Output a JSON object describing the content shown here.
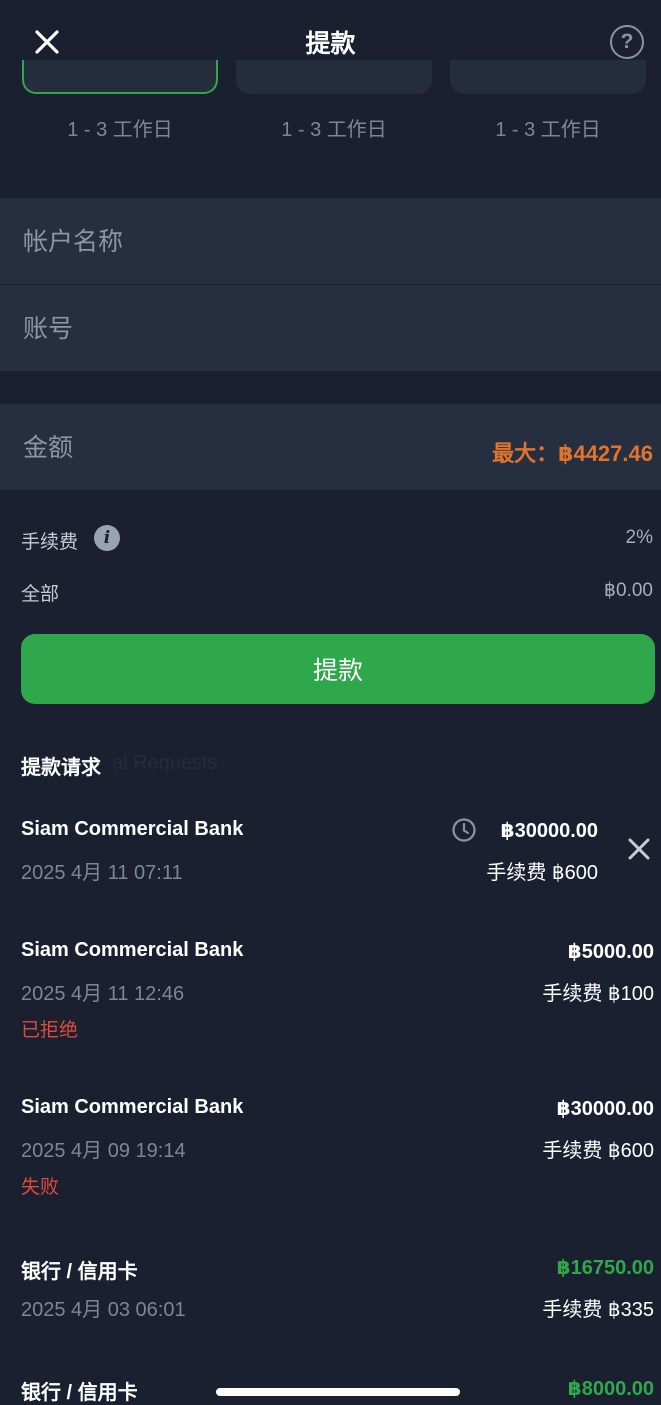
{
  "header": {
    "title": "提款",
    "close_icon": "close-icon",
    "help_icon": "help-icon",
    "help_glyph": "?"
  },
  "methods": [
    {
      "eta": "1 - 3 工作日",
      "selected": true
    },
    {
      "eta": "1 - 3 工作日",
      "selected": false
    },
    {
      "eta": "1 - 3 工作日",
      "selected": false
    }
  ],
  "form": {
    "account_name_placeholder": "帐户名称",
    "account_number_placeholder": "账号",
    "amount_placeholder": "金额",
    "max_label": "最大：฿4427.46"
  },
  "summary": {
    "fee_label": "手续费",
    "fee_value": "2%",
    "fee_info_glyph": "i",
    "total_label": "全部",
    "total_value": "฿0.00"
  },
  "submit_label": "提款",
  "requests": {
    "title": "提款请求",
    "ghost_text": "al Requests",
    "items": [
      {
        "bank": "Siam Commercial Bank",
        "date": "2025 4月 11 07:11",
        "amount": "฿30000.00",
        "fee": "手续费 ฿600",
        "status": "",
        "pending": true
      },
      {
        "bank": "Siam Commercial Bank",
        "date": "2025 4月 11 12:46",
        "amount": "฿5000.00",
        "fee": "手续费 ฿100",
        "status": "已拒绝"
      },
      {
        "bank": "Siam Commercial Bank",
        "date": "2025 4月 09 19:14",
        "amount": "฿30000.00",
        "fee": "手续费 ฿600",
        "status": "失败"
      },
      {
        "bank": "银行 / 信用卡",
        "date": "2025 4月 03 06:01",
        "amount": "฿16750.00",
        "fee": "手续费 ฿335",
        "status": ""
      },
      {
        "bank": "银行 / 信用卡",
        "date": "",
        "amount": "฿8000.00",
        "fee": "",
        "status": ""
      }
    ]
  },
  "colors": {
    "background": "#1a2030",
    "field": "#262f40",
    "accent_green": "#2ea84a",
    "max_orange": "#e0742c",
    "status_red": "#e04a3c"
  }
}
